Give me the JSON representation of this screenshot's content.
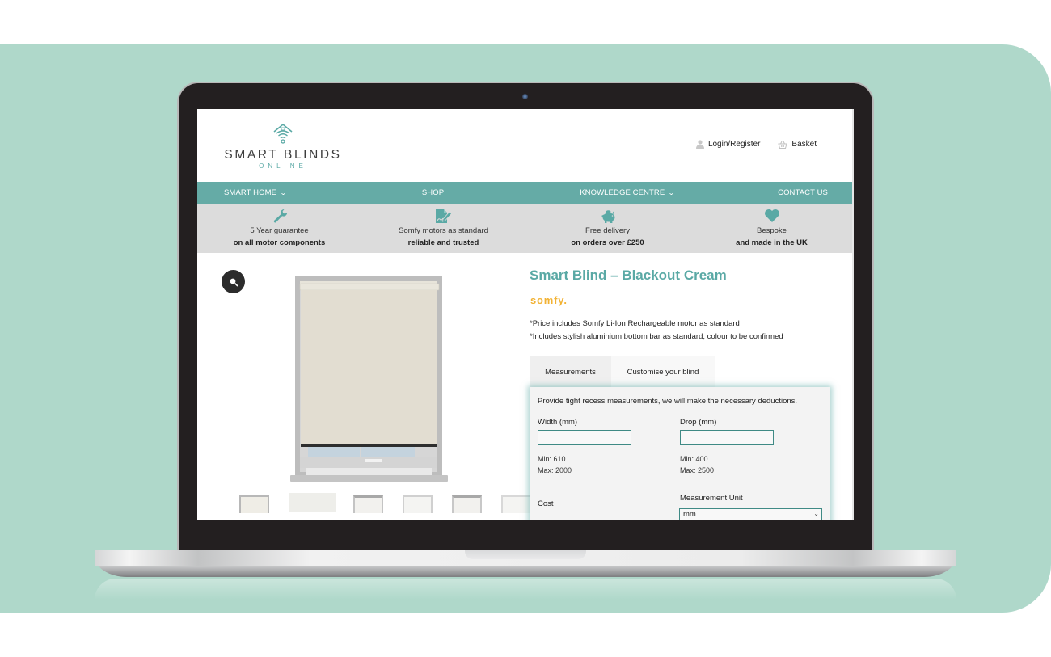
{
  "site": {
    "logo_main": "SMART BLINDS",
    "logo_sub": "ONLINE",
    "header_links": [
      {
        "label": "Login/Register",
        "icon": "user-icon"
      },
      {
        "label": "Basket",
        "icon": "basket-icon"
      }
    ]
  },
  "nav": {
    "items": [
      {
        "label": "SMART HOME",
        "has_dropdown": true
      },
      {
        "label": "SHOP",
        "has_dropdown": false
      },
      {
        "label": "KNOWLEDGE CENTRE",
        "has_dropdown": true
      },
      {
        "label": "CONTACT US",
        "has_dropdown": false
      }
    ],
    "dropdown_glyph": "⌄"
  },
  "usps": [
    {
      "icon": "wrench-icon",
      "line1": "5 Year guarantee",
      "line2": "on all motor components"
    },
    {
      "icon": "signature-document-icon",
      "line1": "Somfy motors as standard",
      "line2": "reliable and trusted"
    },
    {
      "icon": "piggy-bank-icon",
      "line1": "Free delivery",
      "line2": "on orders over £250"
    },
    {
      "icon": "heart-icon",
      "line1": "Bespoke",
      "line2": "and made in the UK"
    }
  ],
  "product": {
    "title": "Smart Blind – Blackout Cream",
    "brand": "somfy.",
    "notes": [
      "*Price includes Somfy Li-Ion Rechargeable motor as standard",
      "*Includes stylish aluminium bottom bar as standard, colour to be confirmed"
    ],
    "thumbnail_count": 6
  },
  "tabs": [
    {
      "label": "Measurements",
      "active": true
    },
    {
      "label": "Customise your blind",
      "active": false
    }
  ],
  "measurements": {
    "intro": "Provide tight recess measurements, we will make the necessary deductions.",
    "width": {
      "label": "Width (mm)",
      "value": "",
      "min": "Min: 610",
      "max": "Max: 2000"
    },
    "drop": {
      "label": "Drop (mm)",
      "value": "",
      "min": "Min: 400",
      "max": "Max: 2500"
    },
    "cost_label": "Cost",
    "unit_label": "Measurement Unit",
    "unit_value": "mm"
  },
  "colors": {
    "brand_teal": "#65aba6",
    "title_teal": "#5aa9a5",
    "backdrop_mint": "#afd8ca",
    "somfy_yellow": "#f2b233"
  }
}
